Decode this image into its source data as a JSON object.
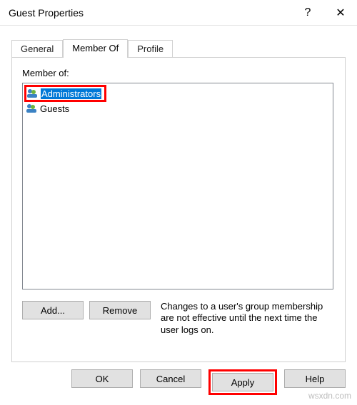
{
  "titlebar": {
    "title": "Guest Properties",
    "help": "?",
    "close": "✕"
  },
  "tabs": {
    "general": "General",
    "member_of": "Member Of",
    "profile": "Profile"
  },
  "panel": {
    "member_label": "Member of:"
  },
  "list": {
    "items": [
      {
        "icon": "group-icon",
        "label": "Administrators",
        "selected": true
      },
      {
        "icon": "group-icon",
        "label": "Guests",
        "selected": false
      }
    ]
  },
  "buttons": {
    "add": "Add...",
    "remove": "Remove",
    "ok": "OK",
    "cancel": "Cancel",
    "apply": "Apply",
    "help": "Help"
  },
  "note": "Changes to a user's group membership are not effective until the next time the user logs on.",
  "watermark": "wsxdn.com"
}
